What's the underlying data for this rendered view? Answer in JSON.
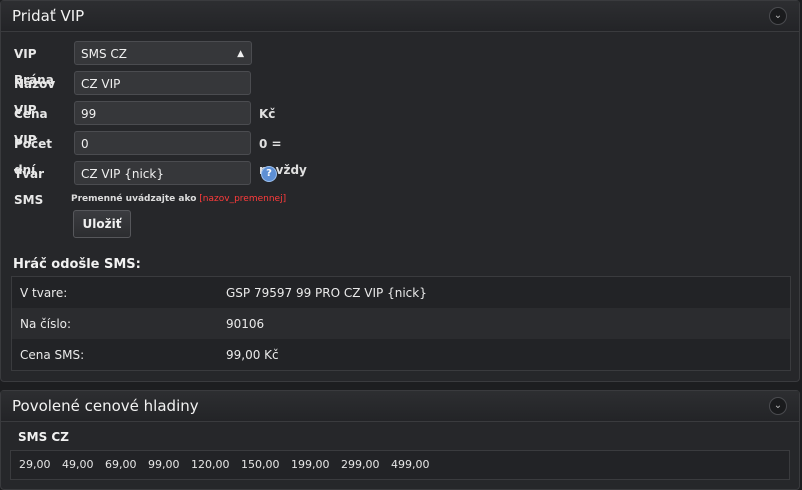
{
  "panel1": {
    "title": "Pridať VIP",
    "form": {
      "gateway_label": "VIP Brána",
      "gateway_value": "SMS CZ",
      "name_label": "Názov VIP",
      "name_value": "CZ VIP",
      "price_label": "Cena VIP",
      "price_value": "99",
      "price_suffix": "Kč",
      "days_label": "Počet dní",
      "days_value": "0",
      "days_suffix": "0 = navždy",
      "sms_label": "Tvar SMS",
      "sms_value": "CZ VIP {nick}",
      "hint_text": "Premenné uvádzajte ako",
      "hint_var": "[nazov_premennej]",
      "save_label": "Uložiť"
    },
    "sms_section": {
      "title": "Hráč odošle SMS:",
      "rows": [
        {
          "key": "V tvare:",
          "value": "GSP 79597 99 PRO CZ VIP {nick}"
        },
        {
          "key": "Na číslo:",
          "value": "90106"
        },
        {
          "key": "Cena SMS:",
          "value": "99,00 Kč"
        }
      ]
    }
  },
  "panel2": {
    "title": "Povolené cenové hladiny",
    "subtitle": "SMS CZ",
    "levels": [
      "29,00",
      "49,00",
      "69,00",
      "99,00",
      "120,00",
      "150,00",
      "199,00",
      "299,00",
      "499,00"
    ]
  },
  "icons": {
    "collapse": "chevron-down-icon",
    "help": "help-icon",
    "select": "select-arrows-icon"
  },
  "colors": {
    "background": "#1d1e20",
    "panel": "#26272a",
    "hint_var": "#ff3b3b",
    "help_icon": "#5d8fd4"
  }
}
